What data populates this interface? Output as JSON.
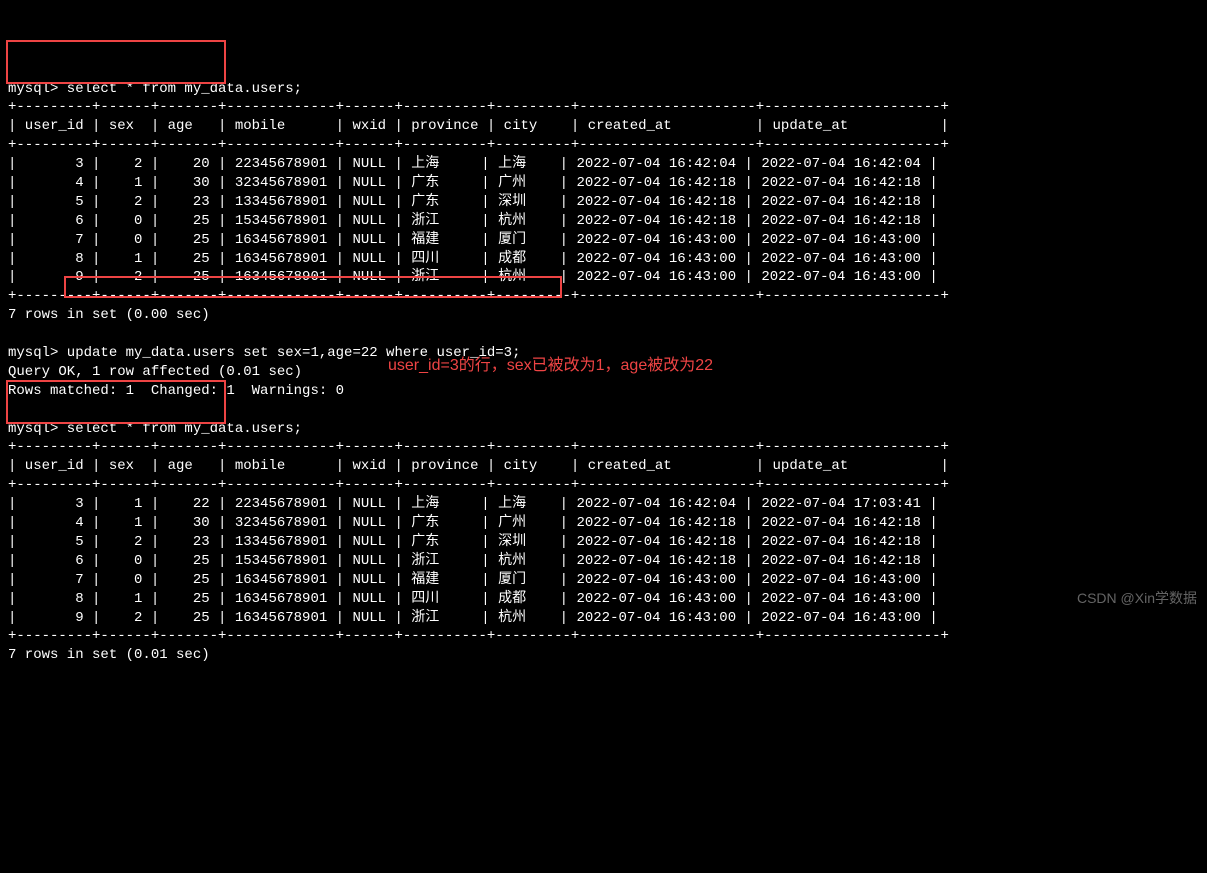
{
  "prompt": "mysql>",
  "queries": {
    "select1": "select * from my_data.users;",
    "update": "update my_data.users set sex=1,age=22 where user_id=3;",
    "select2": "select * from my_data.users;"
  },
  "messages": {
    "query_ok": "Query OK, 1 row affected (0.01 sec)",
    "rows_matched": "Rows matched: 1  Changed: 1  Warnings: 0",
    "rows_in_set1": "7 rows in set (0.00 sec)",
    "rows_in_set2": "7 rows in set (0.01 sec)"
  },
  "annotation": "user_id=3的行，sex已被改为1，age被改为22",
  "watermark": "CSDN @Xin学数据",
  "table1": {
    "headers": [
      "user_id",
      "sex",
      "age",
      "mobile",
      "wxid",
      "province",
      "city",
      "created_at",
      "update_at"
    ],
    "rows": [
      {
        "user_id": "3",
        "sex": "2",
        "age": "20",
        "mobile": "22345678901",
        "wxid": "NULL",
        "province": "上海",
        "city": "上海",
        "created_at": "2022-07-04 16:42:04",
        "update_at": "2022-07-04 16:42:04"
      },
      {
        "user_id": "4",
        "sex": "1",
        "age": "30",
        "mobile": "32345678901",
        "wxid": "NULL",
        "province": "广东",
        "city": "广州",
        "created_at": "2022-07-04 16:42:18",
        "update_at": "2022-07-04 16:42:18"
      },
      {
        "user_id": "5",
        "sex": "2",
        "age": "23",
        "mobile": "13345678901",
        "wxid": "NULL",
        "province": "广东",
        "city": "深圳",
        "created_at": "2022-07-04 16:42:18",
        "update_at": "2022-07-04 16:42:18"
      },
      {
        "user_id": "6",
        "sex": "0",
        "age": "25",
        "mobile": "15345678901",
        "wxid": "NULL",
        "province": "浙江",
        "city": "杭州",
        "created_at": "2022-07-04 16:42:18",
        "update_at": "2022-07-04 16:42:18"
      },
      {
        "user_id": "7",
        "sex": "0",
        "age": "25",
        "mobile": "16345678901",
        "wxid": "NULL",
        "province": "福建",
        "city": "厦门",
        "created_at": "2022-07-04 16:43:00",
        "update_at": "2022-07-04 16:43:00"
      },
      {
        "user_id": "8",
        "sex": "1",
        "age": "25",
        "mobile": "16345678901",
        "wxid": "NULL",
        "province": "四川",
        "city": "成都",
        "created_at": "2022-07-04 16:43:00",
        "update_at": "2022-07-04 16:43:00"
      },
      {
        "user_id": "9",
        "sex": "2",
        "age": "25",
        "mobile": "16345678901",
        "wxid": "NULL",
        "province": "浙江",
        "city": "杭州",
        "created_at": "2022-07-04 16:43:00",
        "update_at": "2022-07-04 16:43:00"
      }
    ]
  },
  "table2": {
    "headers": [
      "user_id",
      "sex",
      "age",
      "mobile",
      "wxid",
      "province",
      "city",
      "created_at",
      "update_at"
    ],
    "rows": [
      {
        "user_id": "3",
        "sex": "1",
        "age": "22",
        "mobile": "22345678901",
        "wxid": "NULL",
        "province": "上海",
        "city": "上海",
        "created_at": "2022-07-04 16:42:04",
        "update_at": "2022-07-04 17:03:41"
      },
      {
        "user_id": "4",
        "sex": "1",
        "age": "30",
        "mobile": "32345678901",
        "wxid": "NULL",
        "province": "广东",
        "city": "广州",
        "created_at": "2022-07-04 16:42:18",
        "update_at": "2022-07-04 16:42:18"
      },
      {
        "user_id": "5",
        "sex": "2",
        "age": "23",
        "mobile": "13345678901",
        "wxid": "NULL",
        "province": "广东",
        "city": "深圳",
        "created_at": "2022-07-04 16:42:18",
        "update_at": "2022-07-04 16:42:18"
      },
      {
        "user_id": "6",
        "sex": "0",
        "age": "25",
        "mobile": "15345678901",
        "wxid": "NULL",
        "province": "浙江",
        "city": "杭州",
        "created_at": "2022-07-04 16:42:18",
        "update_at": "2022-07-04 16:42:18"
      },
      {
        "user_id": "7",
        "sex": "0",
        "age": "25",
        "mobile": "16345678901",
        "wxid": "NULL",
        "province": "福建",
        "city": "厦门",
        "created_at": "2022-07-04 16:43:00",
        "update_at": "2022-07-04 16:43:00"
      },
      {
        "user_id": "8",
        "sex": "1",
        "age": "25",
        "mobile": "16345678901",
        "wxid": "NULL",
        "province": "四川",
        "city": "成都",
        "created_at": "2022-07-04 16:43:00",
        "update_at": "2022-07-04 16:43:00"
      },
      {
        "user_id": "9",
        "sex": "2",
        "age": "25",
        "mobile": "16345678901",
        "wxid": "NULL",
        "province": "浙江",
        "city": "杭州",
        "created_at": "2022-07-04 16:43:00",
        "update_at": "2022-07-04 16:43:00"
      }
    ]
  }
}
